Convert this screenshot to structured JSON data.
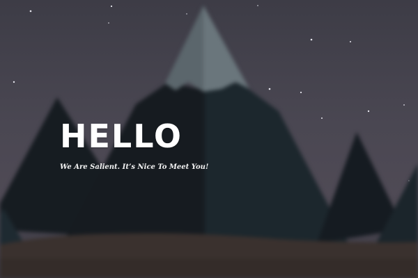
{
  "hero": {
    "title": "HELLO",
    "subtitle": "We Are Salient. It’s Nice To Meet You!"
  },
  "colors": {
    "sky": "#45434d",
    "mountain_dark": "#161b20",
    "mountain_mid": "#1c262c",
    "snow": "#5f6a70",
    "ground": "#3a312e",
    "text": "#ffffff"
  }
}
